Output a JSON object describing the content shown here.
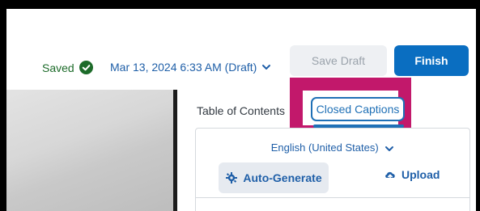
{
  "header": {
    "saved_label": "Saved",
    "date_label": "Mar 13, 2024 6:33 AM (Draft)",
    "save_draft_label": "Save Draft",
    "finish_label": "Finish"
  },
  "tabs": {
    "toc_label": "Table of Contents",
    "captions_label": "Closed Captions"
  },
  "captions_panel": {
    "language_label": "English (United States)",
    "auto_generate_label": "Auto-Generate",
    "upload_label": "Upload"
  },
  "colors": {
    "accent": "#1f70b6",
    "finish_bg": "#0a6ec1",
    "saved_green": "#1d6b2a",
    "highlight": "#c2186b"
  },
  "icons": {
    "saved": "check-circle-icon",
    "date": "chevron-down-icon",
    "language": "chevron-down-icon",
    "auto_generate": "gear-sparkle-icon",
    "upload": "cloud-upload-icon"
  }
}
